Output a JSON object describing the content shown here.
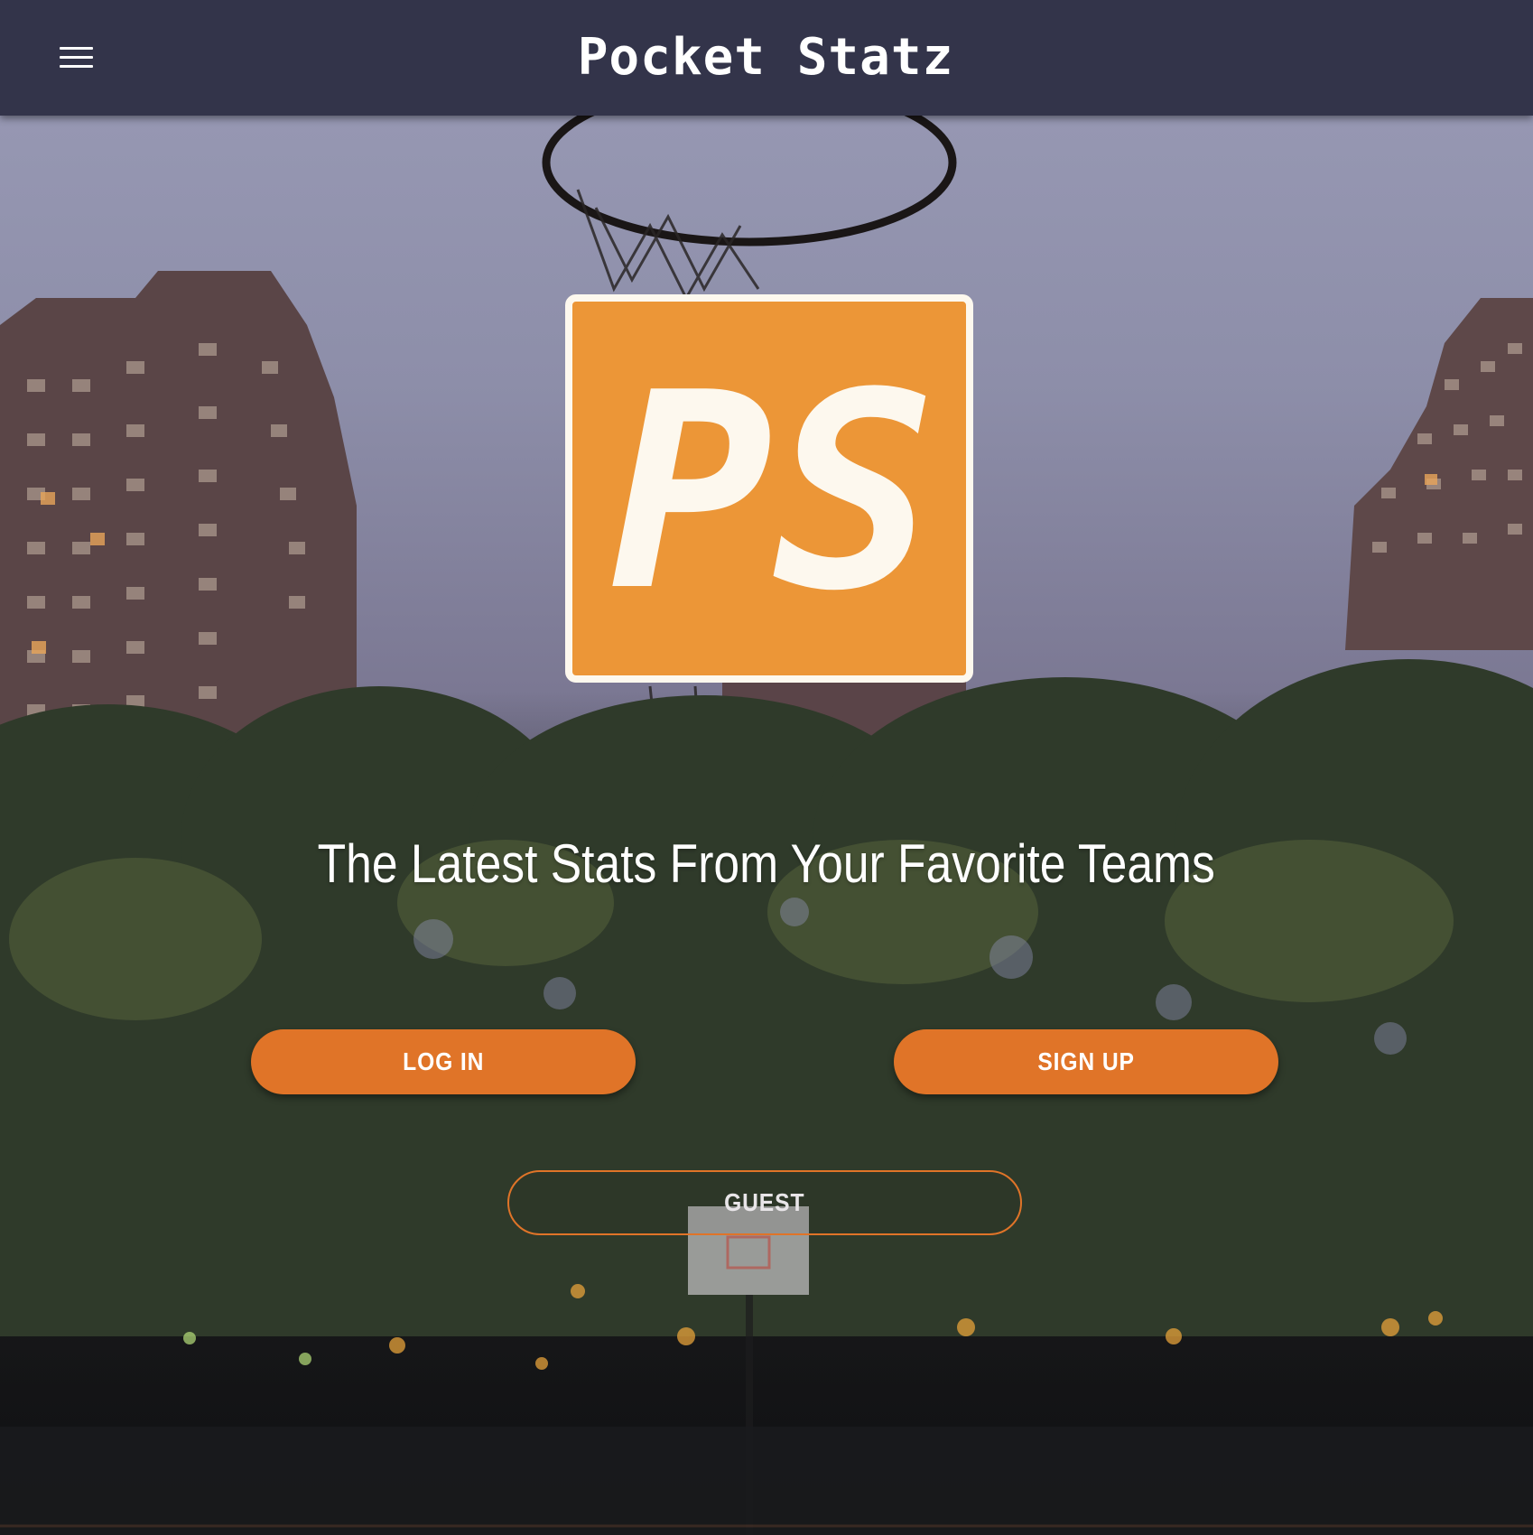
{
  "header": {
    "title": "Pocket Statz",
    "menu_icon": "hamburger-menu-icon"
  },
  "logo": {
    "text": "PS",
    "background_color": "#ec9637",
    "border_color": "#fdf8ee",
    "text_color": "#fdf8ee"
  },
  "hero": {
    "tagline": "The Latest Stats From Your Favorite Teams"
  },
  "actions": {
    "login_label": "LOG IN",
    "signup_label": "SIGN UP",
    "guest_label": "GUEST"
  },
  "colors": {
    "header_bg": "#33344a",
    "accent": "#e07428",
    "text": "#ffffff"
  }
}
